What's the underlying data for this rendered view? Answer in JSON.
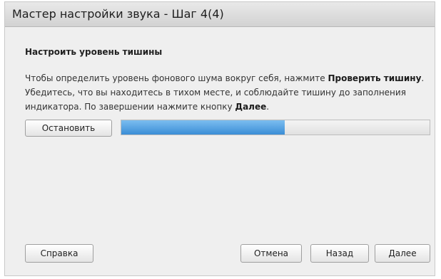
{
  "window": {
    "title": "Мастер настройки звука - Шаг 4(4)"
  },
  "main": {
    "heading": "Настроить уровень тишины",
    "desc_part1": "Чтобы определить уровень фонового шума вокруг себя, нажмите ",
    "desc_bold1": "Проверить тишину",
    "desc_part2": ". Убедитесь, что вы находитесь в тихом месте, и соблюдайте тишину до заполнения индикатора. По завершении нажмите кнопку ",
    "desc_bold2": "Далее",
    "desc_part3": ".",
    "stop_label": "Остановить",
    "progress_percent": 53
  },
  "footer": {
    "help_label": "Справка",
    "cancel_label": "Отмена",
    "back_label": "Назад",
    "next_label": "Далее"
  },
  "colors": {
    "progress_fill": "#3a8dd6",
    "background": "#efefef",
    "titlebar": "#d2d2d2"
  }
}
